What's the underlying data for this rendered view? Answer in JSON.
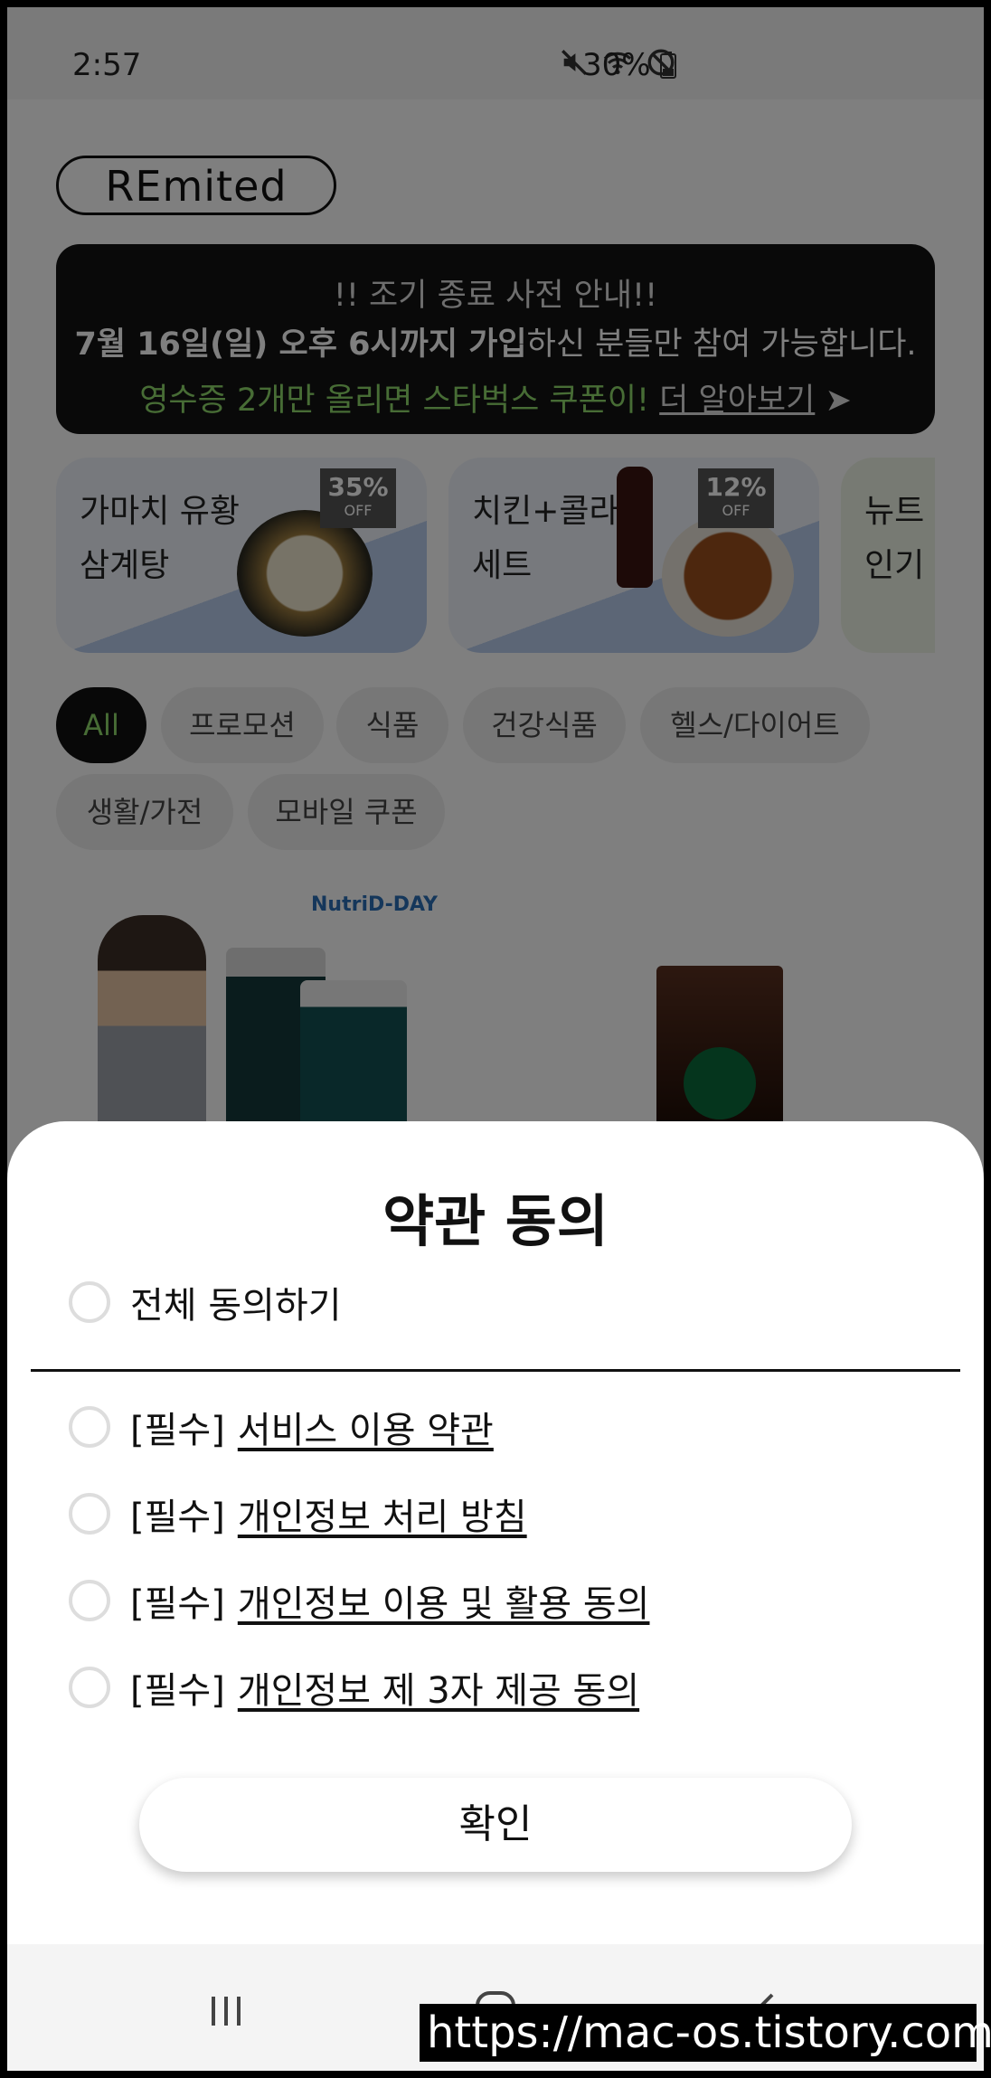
{
  "status_bar": {
    "time": "2:57",
    "battery": "30%",
    "icons": [
      "mute-icon",
      "wifi-icon",
      "do-not-disturb-icon",
      "battery-icon"
    ]
  },
  "header": {
    "logo_text": "REmited"
  },
  "notice": {
    "line1": "!! 조기 종료 사전 안내!!",
    "line2_bold": "7월 16일(일) 오후 6시까지 가입",
    "line2_rest": "하신 분들만 참여 가능합니다.",
    "line3_green": "영수증 2개만 올리면 스타벅스 쿠폰이!",
    "line3_link": "더 알아보기"
  },
  "promos": [
    {
      "label": "가마치 유황\n삼계탕",
      "discount": "35%",
      "off": "OFF"
    },
    {
      "label": "치킨+콜라\n세트",
      "discount": "12%",
      "off": "OFF"
    },
    {
      "label": "뉴트\n인기"
    }
  ],
  "categories": [
    "All",
    "프로모션",
    "식품",
    "건강식품",
    "헬스/다이어트",
    "생활/가전",
    "모바일 쿠폰"
  ],
  "active_category": "All",
  "products": [
    {
      "brand": "NutriD-DAY"
    }
  ],
  "terms_sheet": {
    "title": "약관 동의",
    "agree_all": "전체 동의하기",
    "required_tag": "[필수]",
    "items": [
      "서비스 이용 약관",
      "개인정보 처리 방침",
      "개인정보 이용 및 활용 동의",
      "개인정보 제 3자 제공 동의"
    ],
    "confirm_label": "확인"
  },
  "nav_bar": {
    "buttons": [
      "recent-apps-icon",
      "home-icon",
      "back-icon"
    ]
  },
  "watermark": "https://mac-os.tistory.com",
  "colors": {
    "accent_green": "#8ed96a",
    "notice_bg": "#121212",
    "chip_bg": "#eeeeee",
    "overlay": "rgba(0,0,0,0.5)"
  }
}
